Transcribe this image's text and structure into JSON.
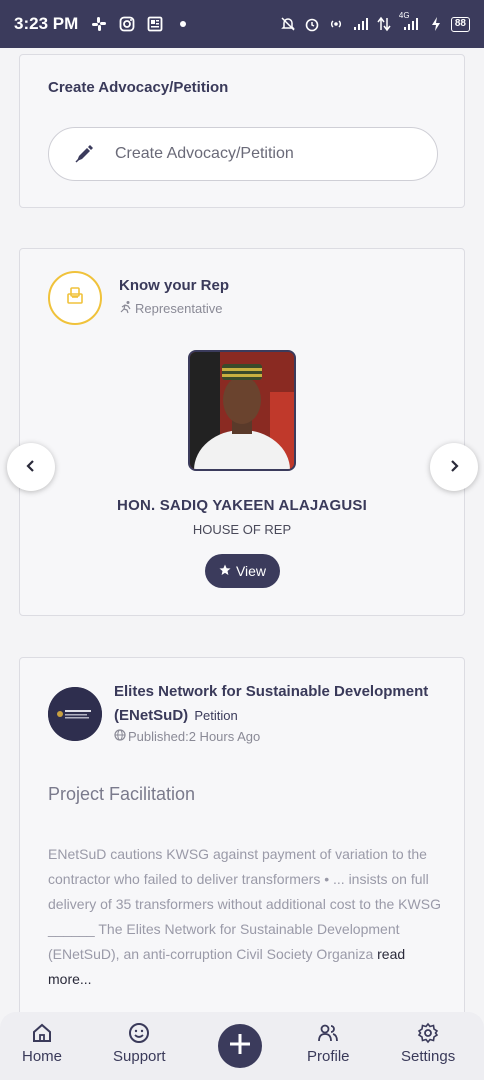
{
  "status_bar": {
    "time": "3:23 PM",
    "battery": "88",
    "network": "4G"
  },
  "create_card": {
    "title": "Create Advocacy/Petition",
    "button_label": "Create Advocacy/Petition",
    "icon": "pen-icon"
  },
  "rep_card": {
    "title": "Know your Rep",
    "subtitle": "Representative",
    "name": "HON. SADIQ YAKEEN ALAJAGUSI",
    "office": "HOUSE OF REP",
    "view_label": "View",
    "badge_color": "#f0c23b"
  },
  "post_card": {
    "org_name": "Elites Network for Sustainable Development (ENetSuD)",
    "type_tag": "Petition",
    "published": "Published:2 Hours Ago",
    "title": "Project Facilitation",
    "body": "ENetSuD cautions KWSG against payment of variation to the contractor who failed to deliver transformers • ... insists on full delivery of 35 transformers without additional cost to the KWSG ______ The Elites Network for Sustainable Development (ENetSuD), an anti-corruption Civil Society Organiza",
    "read_more": "read more..."
  },
  "bottom_nav": {
    "home": "Home",
    "support": "Support",
    "profile": "Profile",
    "settings": "Settings"
  },
  "colors": {
    "primary": "#3b3b5c",
    "accent": "#f0c23b"
  }
}
